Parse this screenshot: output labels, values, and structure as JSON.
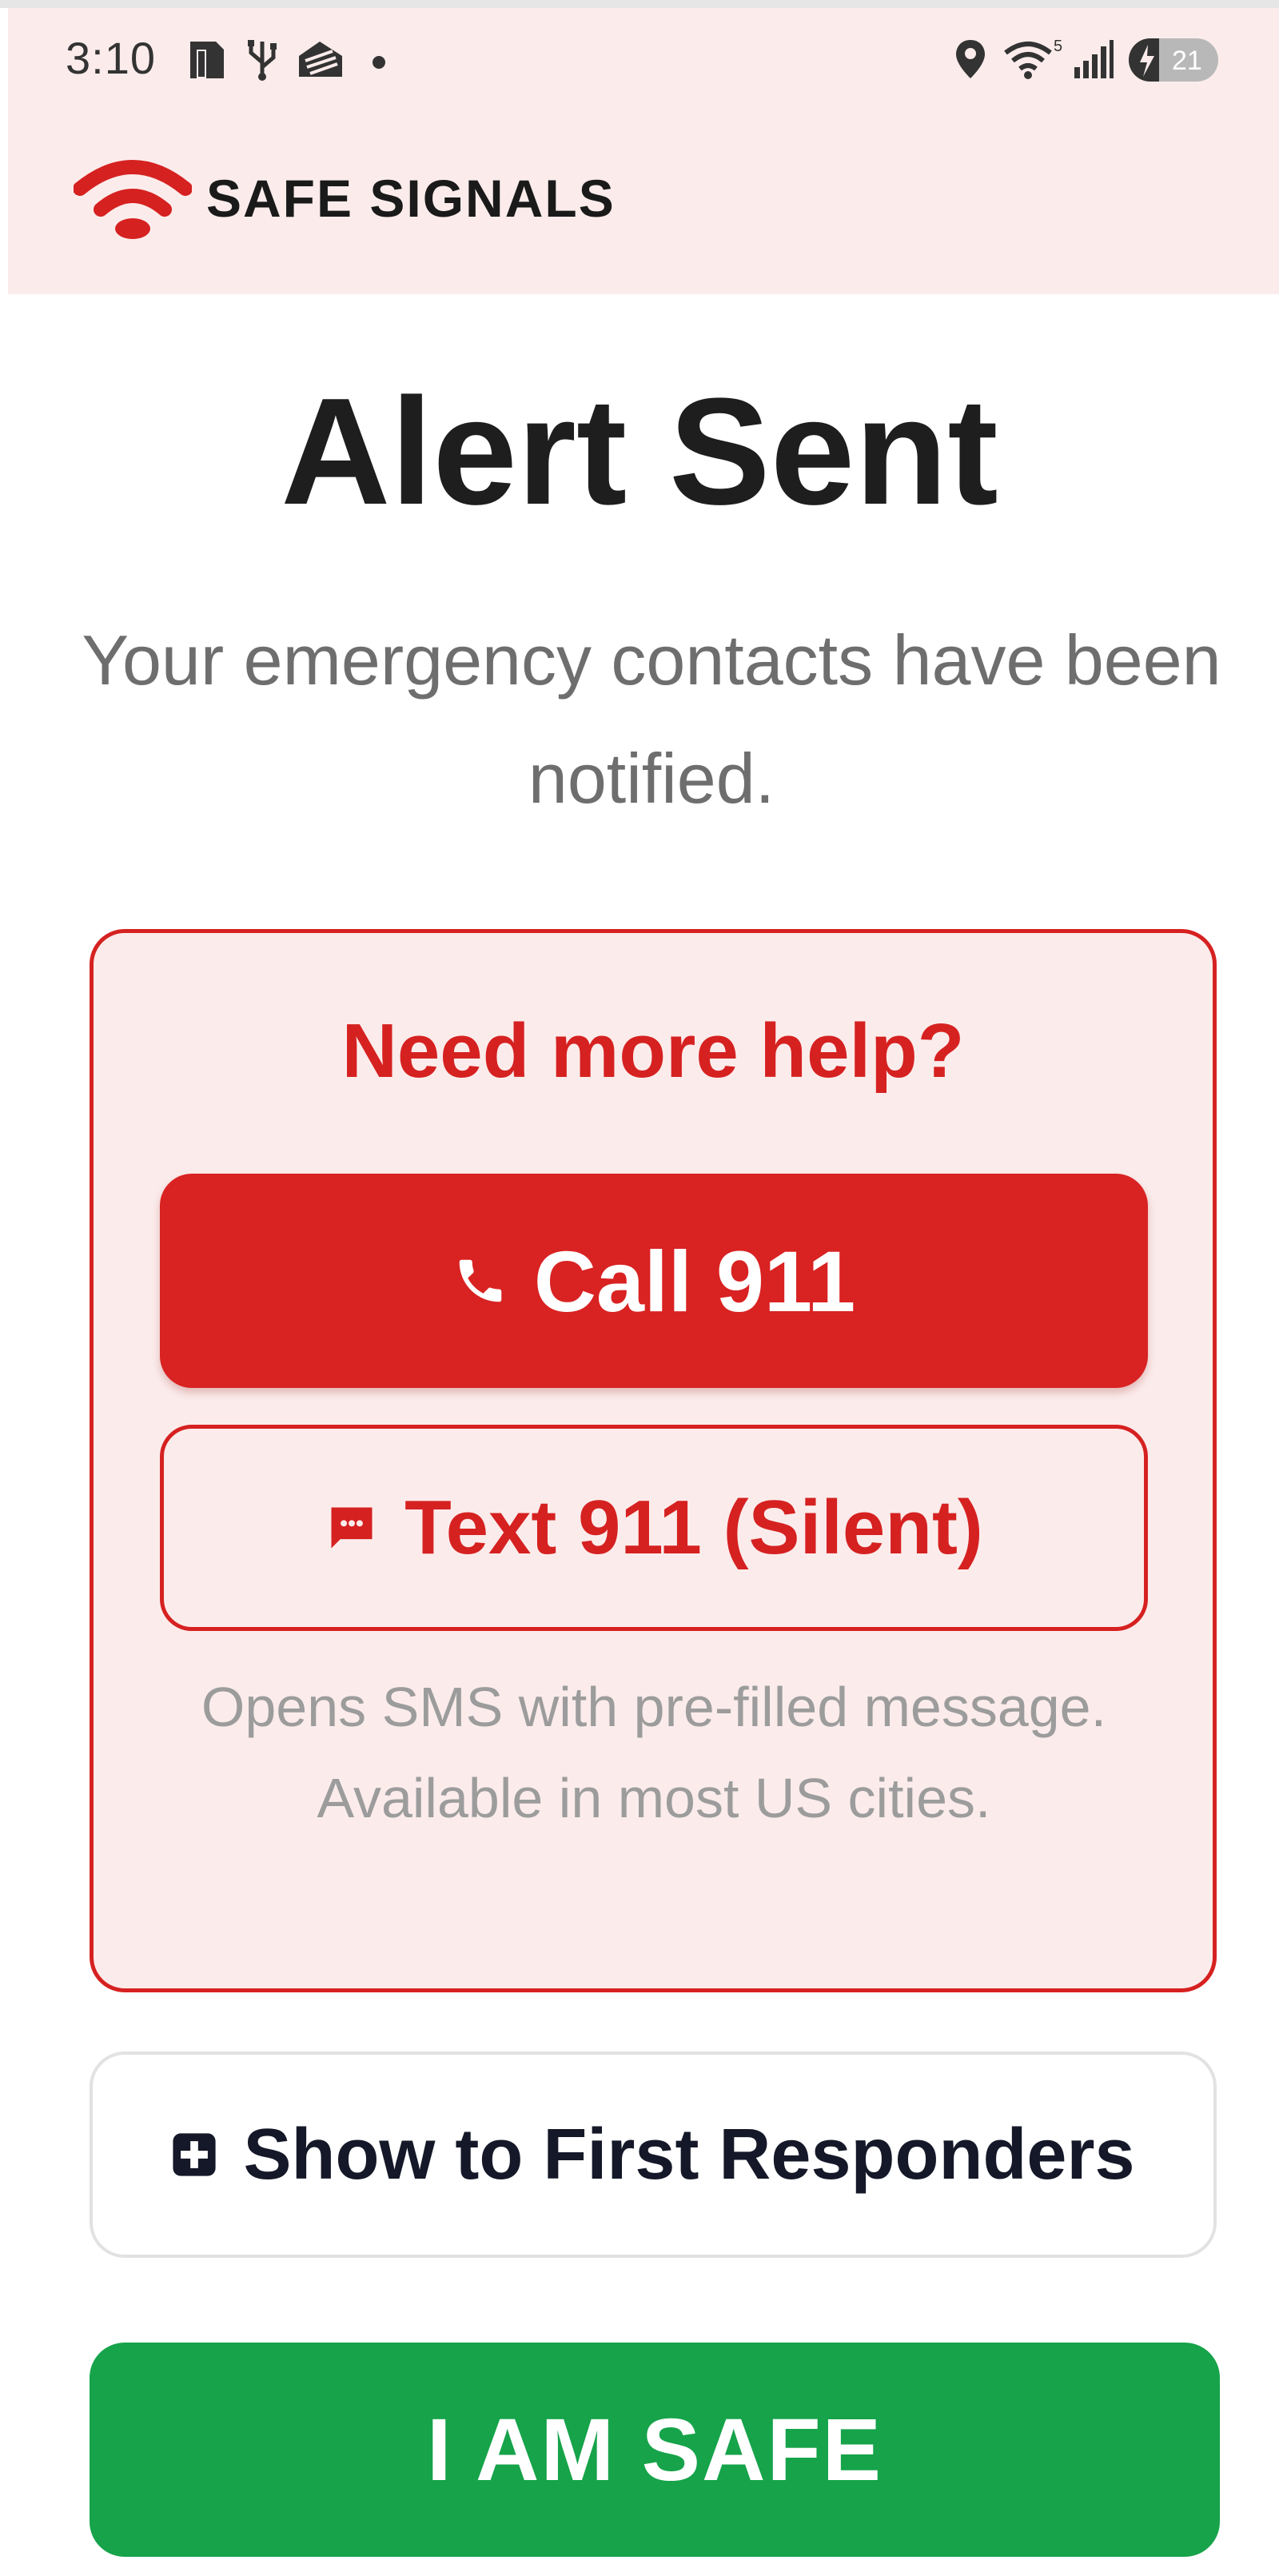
{
  "status_bar": {
    "time": "3:10",
    "left_icons": [
      "sim-card-icon",
      "usb-icon",
      "app-notification-icon",
      "dot-icon"
    ],
    "right_icons": [
      "location-icon",
      "wifi-icon",
      "signal-icon",
      "battery-icon"
    ],
    "wifi_badge": "5",
    "battery_level": "21"
  },
  "header": {
    "brand_name": "SAFE SIGNALS",
    "logo_icon": "signal-logo-icon"
  },
  "main": {
    "title": "Alert Sent",
    "subtitle": "Your emergency contacts have been notified."
  },
  "help": {
    "title": "Need more help?",
    "call_label": "Call 911",
    "call_icon": "phone-icon",
    "text_label": "Text 911 (Silent)",
    "text_icon": "message-icon",
    "note": "Opens SMS with pre-filled message. Available in most US cities."
  },
  "responders": {
    "label": "Show to First Responders",
    "icon": "medical-plus-icon"
  },
  "safe": {
    "label": "I AM SAFE"
  },
  "colors": {
    "brand_red": "#d62121",
    "panel_tint": "#fbeceb",
    "safe_green": "#16a34a",
    "title_dark": "#1e1e1e"
  }
}
